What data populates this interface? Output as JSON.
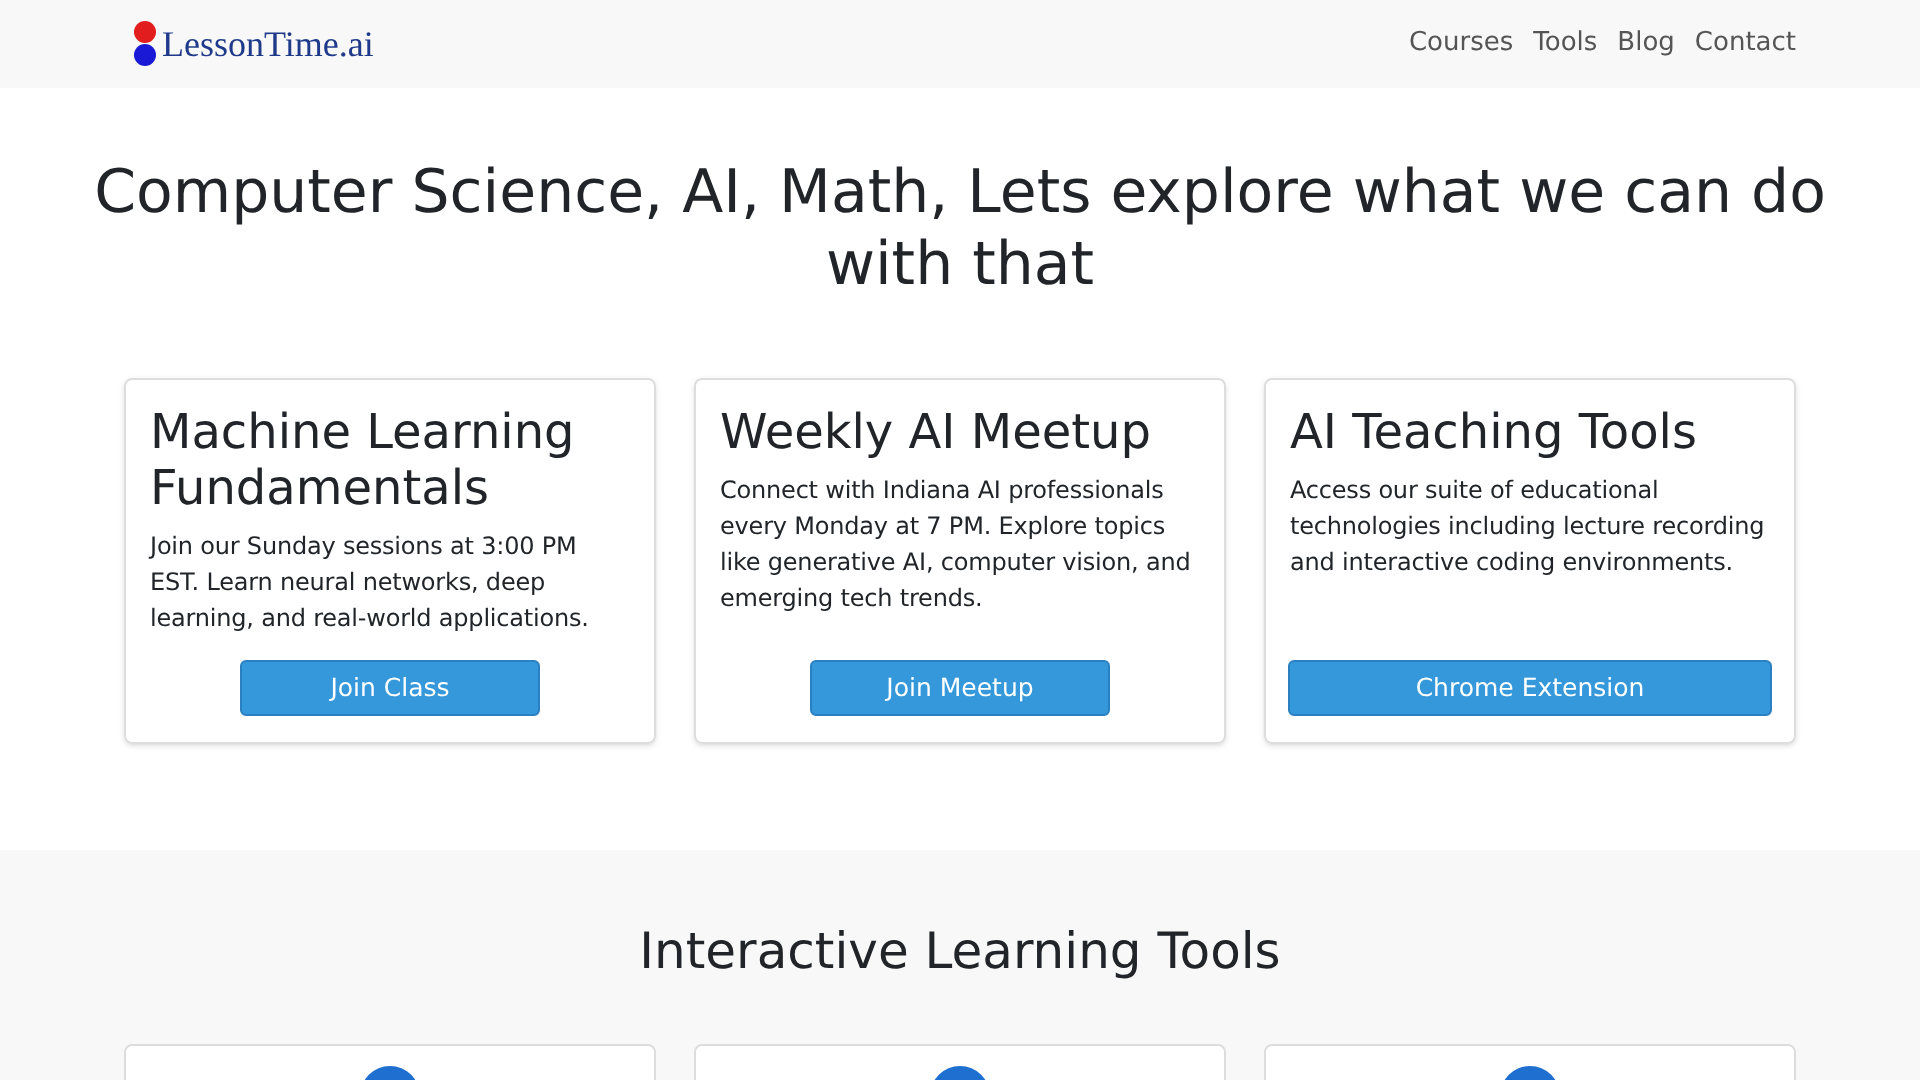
{
  "brand": "LessonTime.ai",
  "nav": [
    "Courses",
    "Tools",
    "Blog",
    "Contact"
  ],
  "hero_title": "Computer Science, AI, Math, Lets explore what we can do with that",
  "cards": [
    {
      "title": "Machine Learning Fundamentals",
      "text": "Join our Sunday sessions at 3:00 PM EST. Learn neural networks, deep learning, and real-world applications.",
      "button": "Join Class",
      "wide": false
    },
    {
      "title": "Weekly AI Meetup",
      "text": "Connect with Indiana AI professionals every Monday at 7 PM. Explore topics like generative AI, computer vision, and emerging tech trends.",
      "button": "Join Meetup",
      "wide": false
    },
    {
      "title": "AI Teaching Tools",
      "text": "Access our suite of educational technologies including lecture recording and interactive coding environments.",
      "button": "Chrome Extension",
      "wide": true
    }
  ],
  "tools_section": {
    "title": "Interactive Learning Tools"
  }
}
